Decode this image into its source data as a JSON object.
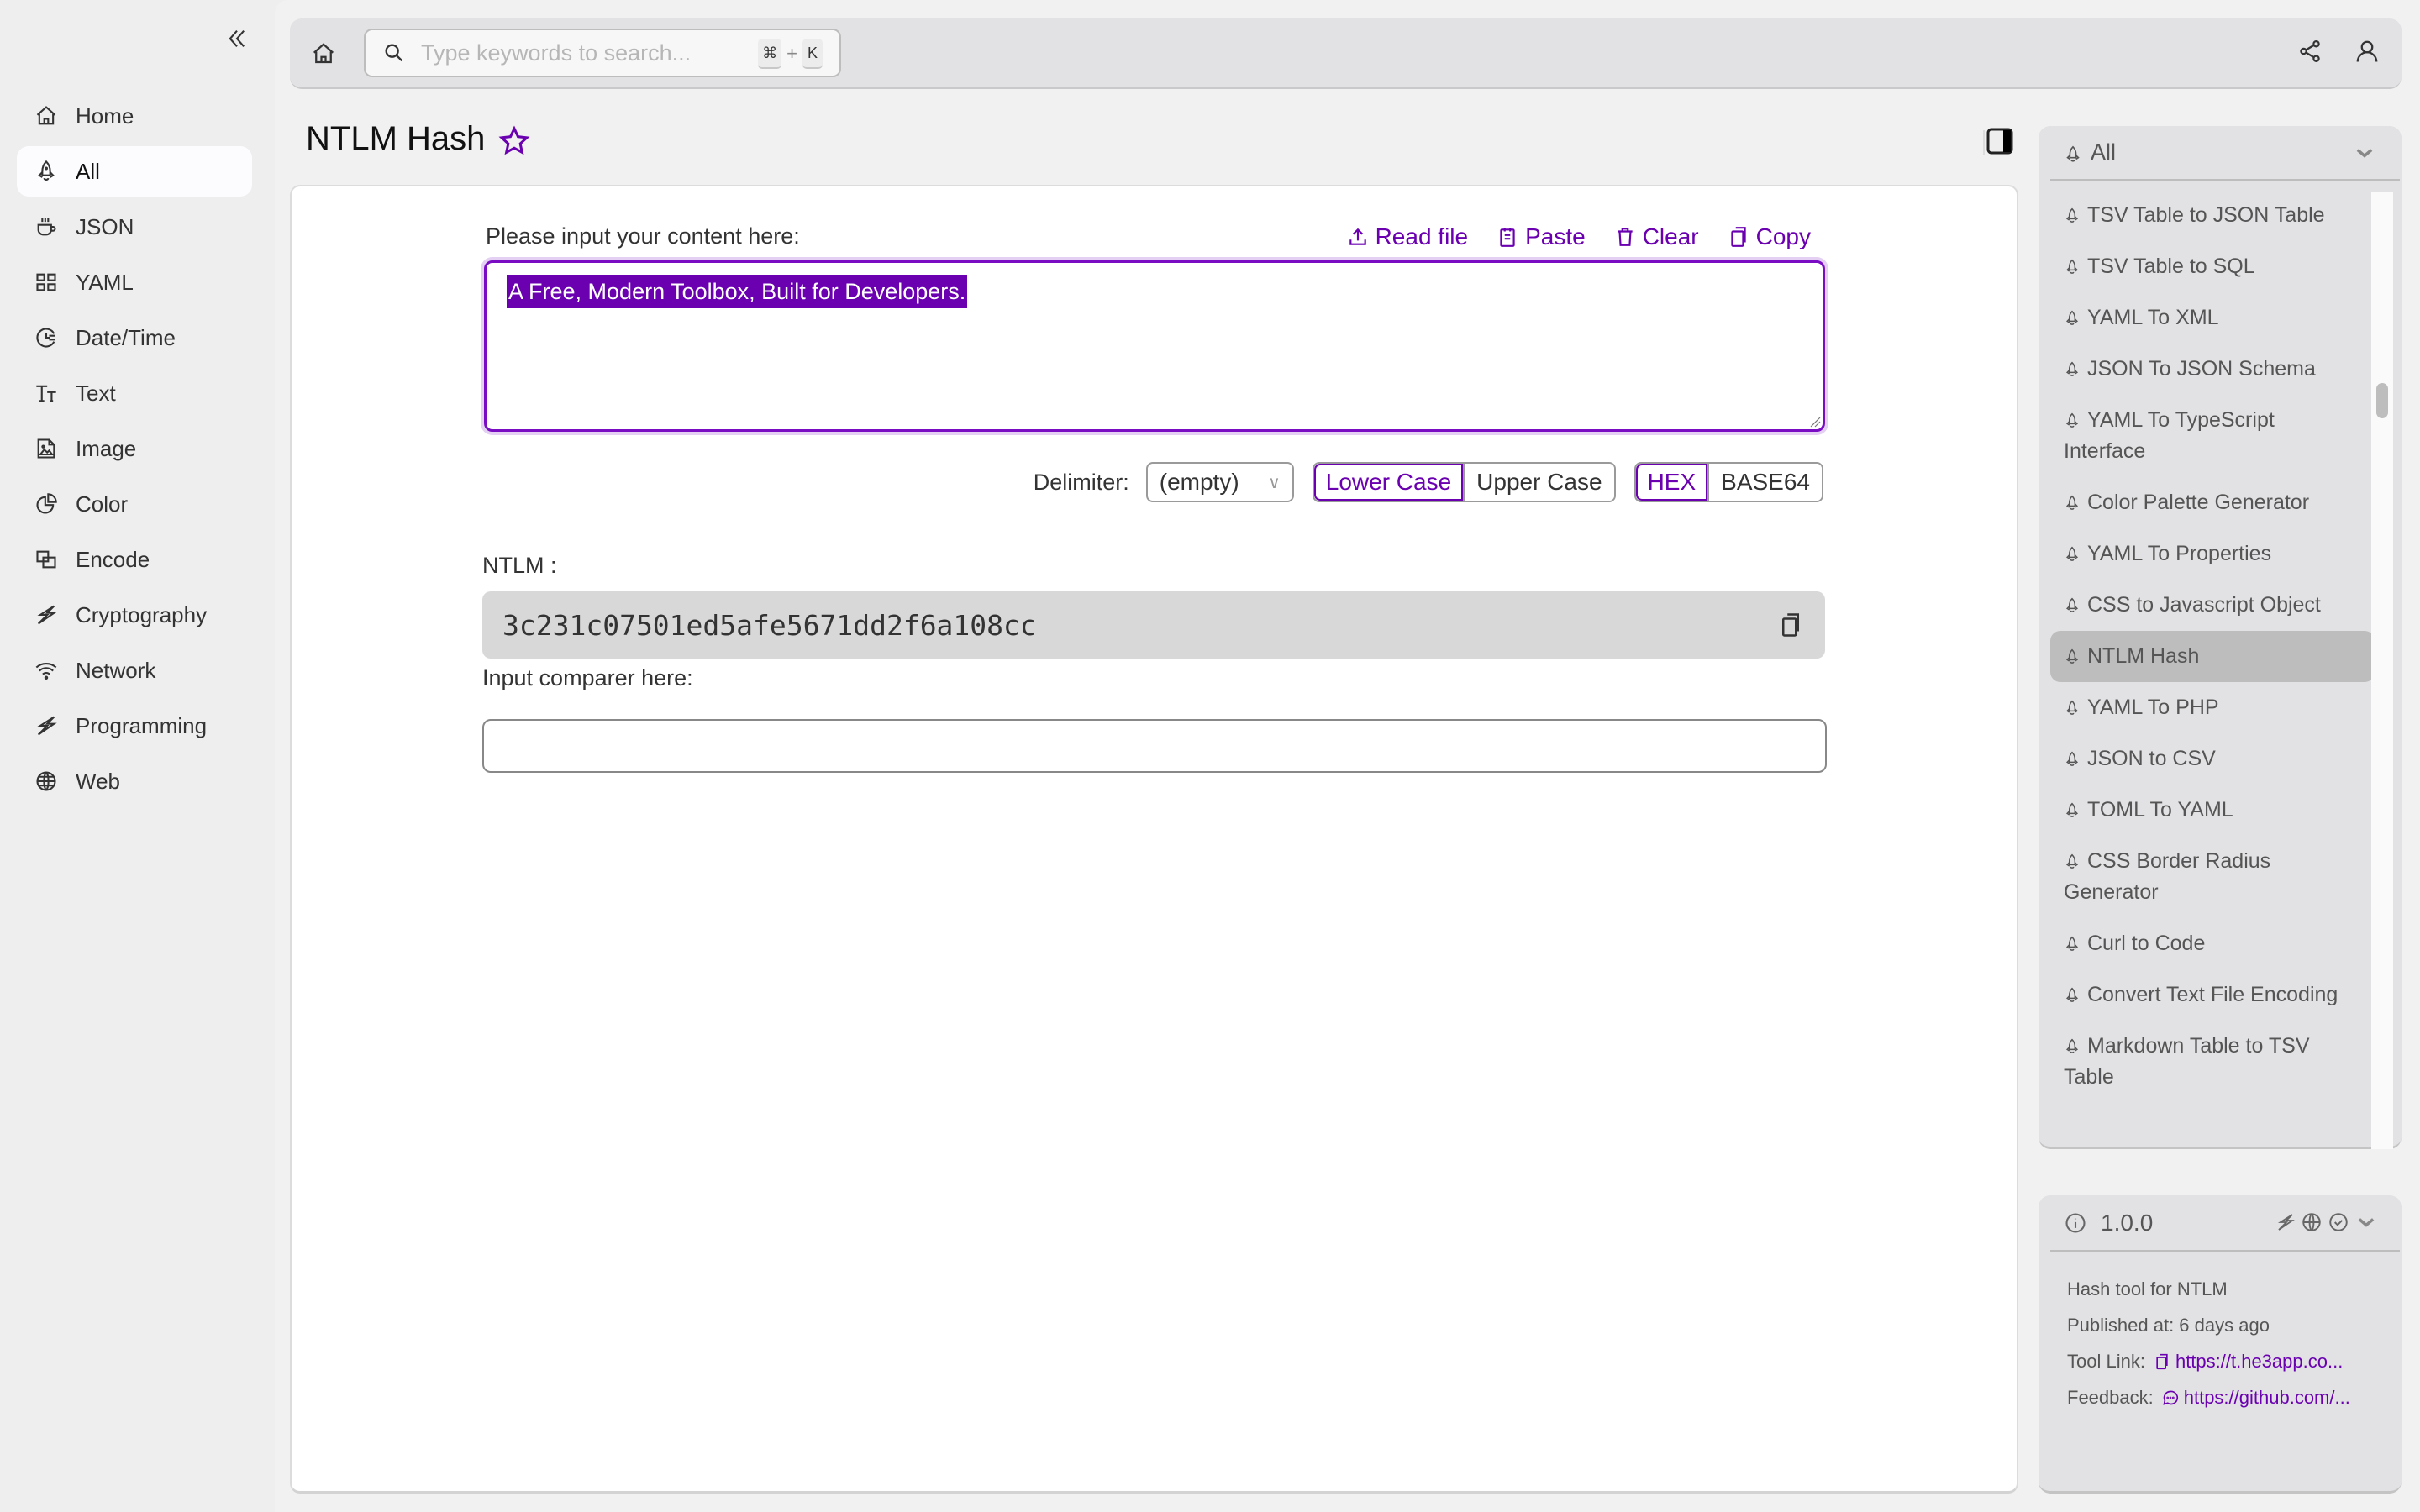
{
  "sidebar": {
    "collapse_icon": "double-chevron-left-icon",
    "items": [
      {
        "label": "Home",
        "icon": "home-icon",
        "active": false
      },
      {
        "label": "All",
        "icon": "rocket-icon",
        "active": true
      },
      {
        "label": "JSON",
        "icon": "coffee-cup-icon",
        "active": false
      },
      {
        "label": "YAML",
        "icon": "grid-icon",
        "active": false
      },
      {
        "label": "Date/Time",
        "icon": "clock-icon",
        "active": false
      },
      {
        "label": "Text",
        "icon": "text-size-icon",
        "active": false
      },
      {
        "label": "Image",
        "icon": "image-icon",
        "active": false
      },
      {
        "label": "Color",
        "icon": "pie-chart-icon",
        "active": false
      },
      {
        "label": "Encode",
        "icon": "overlap-squares-icon",
        "active": false
      },
      {
        "label": "Cryptography",
        "icon": "lightning-icon",
        "active": false
      },
      {
        "label": "Network",
        "icon": "wifi-icon",
        "active": false
      },
      {
        "label": "Programming",
        "icon": "lightning-icon",
        "active": false
      },
      {
        "label": "Web",
        "icon": "globe-icon",
        "active": false
      }
    ]
  },
  "topbar": {
    "search_placeholder": "Type keywords to search...",
    "shortcut_mod": "⌘",
    "shortcut_plus": "+",
    "shortcut_key": "K"
  },
  "page": {
    "title": "NTLM Hash",
    "favorite": false
  },
  "tool": {
    "input_label": "Please input your content here:",
    "actions": {
      "read_file": "Read file",
      "paste": "Paste",
      "clear": "Clear",
      "copy": "Copy"
    },
    "input_value": "A Free, Modern Toolbox, Built for Developers.",
    "delimiter_label": "Delimiter:",
    "delimiter_value": "(empty)",
    "case_options": [
      "Lower Case",
      "Upper Case"
    ],
    "case_selected": "Lower Case",
    "encoding_options": [
      "HEX",
      "BASE64"
    ],
    "encoding_selected": "HEX",
    "result_label": "NTLM :",
    "result_value": "3c231c07501ed5afe5671dd2f6a108cc",
    "comparer_label": "Input comparer here:",
    "comparer_value": ""
  },
  "tool_panel": {
    "category": "All",
    "items": [
      {
        "label": "TSV Table to JSON Table",
        "active": false
      },
      {
        "label": "TSV Table to SQL",
        "active": false
      },
      {
        "label": "YAML To XML",
        "active": false
      },
      {
        "label": "JSON To JSON Schema",
        "active": false
      },
      {
        "label": "YAML To TypeScript Interface",
        "active": false
      },
      {
        "label": "Color Palette Generator",
        "active": false
      },
      {
        "label": "YAML To Properties",
        "active": false
      },
      {
        "label": "CSS to Javascript Object",
        "active": false
      },
      {
        "label": "NTLM Hash",
        "active": true
      },
      {
        "label": "YAML To PHP",
        "active": false
      },
      {
        "label": "JSON to CSV",
        "active": false
      },
      {
        "label": "TOML To YAML",
        "active": false
      },
      {
        "label": "CSS Border Radius Generator",
        "active": false
      },
      {
        "label": "Curl to Code",
        "active": false
      },
      {
        "label": "Convert Text File Encoding",
        "active": false
      },
      {
        "label": "Markdown Table to TSV Table",
        "active": false
      }
    ]
  },
  "info": {
    "version": "1.0.0",
    "description": "Hash tool for NTLM",
    "published": "Published at: 6 days ago",
    "tool_link_label": "Tool Link:",
    "tool_link": "https://t.he3app.co...",
    "feedback_label": "Feedback:",
    "feedback_link": "https://github.com/..."
  },
  "colors": {
    "accent": "#6a00b0",
    "selection_bg": "#6a00b0",
    "active_tool_bg": "#bdbdbd",
    "result_bg": "#d8d8d8"
  }
}
